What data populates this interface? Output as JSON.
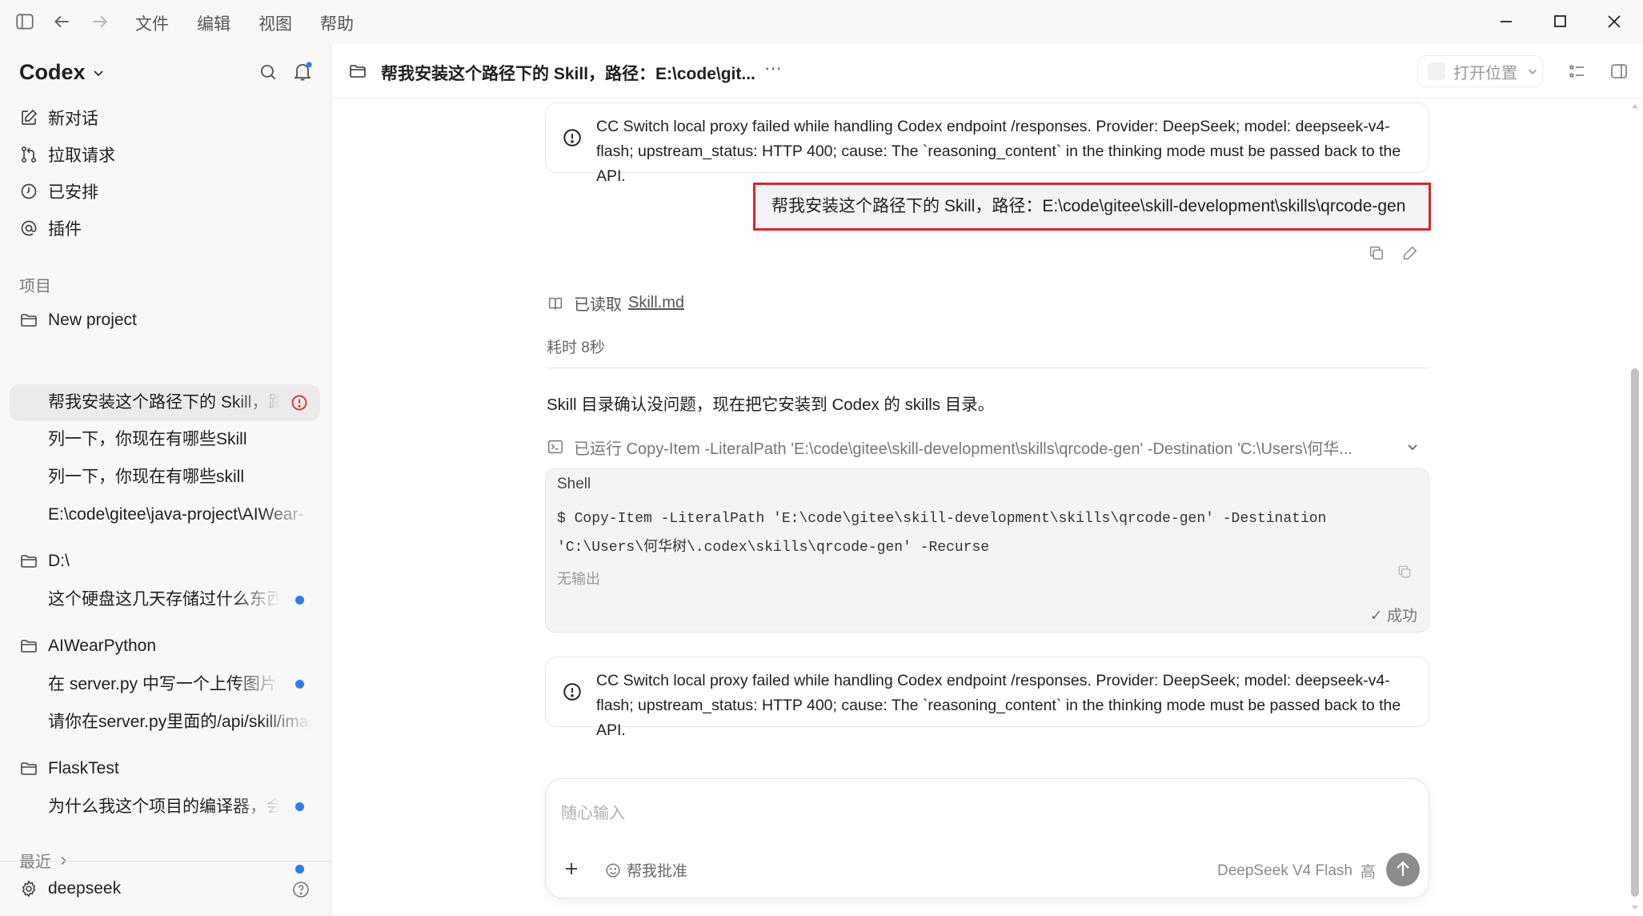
{
  "menu": [
    "文件",
    "编辑",
    "视图",
    "帮助"
  ],
  "sidebar": {
    "app_name": "Codex",
    "nav": [
      {
        "label": "新对话",
        "icon": "edit-icon"
      },
      {
        "label": "拉取请求",
        "icon": "pull-request-icon"
      },
      {
        "label": "已安排",
        "icon": "clock-icon"
      },
      {
        "label": "插件",
        "icon": "at-icon"
      }
    ],
    "projects_label": "项目",
    "projects": [
      {
        "name": "New project",
        "threads": [
          {
            "title": "帮我安装这个路径下的 Skill，路径：E:\\code\\gitee\\skill-development\\skills\\qrcode-gen",
            "active": true,
            "error": true
          },
          {
            "title": "列一下，你现在有哪些Skill"
          },
          {
            "title": "列一下，你现在有哪些skill"
          },
          {
            "title": "E:\\code\\gitee\\java-project\\AIWear-"
          }
        ]
      },
      {
        "name": "D:\\",
        "threads": [
          {
            "title": "这个硬盘这几天存储过什么东西",
            "unread": true
          }
        ]
      },
      {
        "name": "AIWearPython",
        "threads": [
          {
            "title": "在 server.py 中写一个上传图片",
            "unread": true
          },
          {
            "title": "请你在server.py里面的/api/skill/image"
          }
        ]
      },
      {
        "name": "FlaskTest",
        "threads": [
          {
            "title": "为什么我这个项目的编译器，会",
            "unread": true
          }
        ]
      }
    ],
    "recent_label": "最近",
    "footer_user": "deepseek"
  },
  "header": {
    "title": "帮我安装这个路径下的 Skill，路径：E:\\code\\git...",
    "more": "···",
    "open_location": "打开位置"
  },
  "conversation": {
    "error_text": "CC Switch local proxy failed while handling Codex endpoint /responses. Provider: DeepSeek; model: deepseek-v4-flash; upstream_status: HTTP 400; cause: The `reasoning_content` in the thinking mode must be passed back to the API.",
    "user_message": "帮我安装这个路径下的 Skill，路径：E:\\code\\gitee\\skill-development\\skills\\qrcode-gen",
    "read_prefix": "已读取",
    "read_file": "Skill.md",
    "elapsed": "耗时 8秒",
    "assistant_text": "Skill 目录确认没问题，现在把它安装到 Codex 的 skills 目录。",
    "ran_command": "已运行 Copy-Item -LiteralPath 'E:\\code\\gitee\\skill-development\\skills\\qrcode-gen' -Destination 'C:\\Users\\何华...",
    "shell": {
      "label": "Shell",
      "line1": "$ Copy-Item -LiteralPath 'E:\\code\\gitee\\skill-development\\skills\\qrcode-gen' -Destination",
      "line2": "'C:\\Users\\何华树\\.codex\\skills\\qrcode-gen' -Recurse",
      "no_output": "无输出",
      "status": "✓ 成功"
    }
  },
  "composer": {
    "placeholder": "随心输入",
    "approve_label": "帮我批准",
    "model": "DeepSeek V4 Flash",
    "effort": "高"
  },
  "colors": {
    "accent_blue": "#2b7cf0",
    "error_red": "#d9262b",
    "highlight_border": "#d9262b"
  }
}
